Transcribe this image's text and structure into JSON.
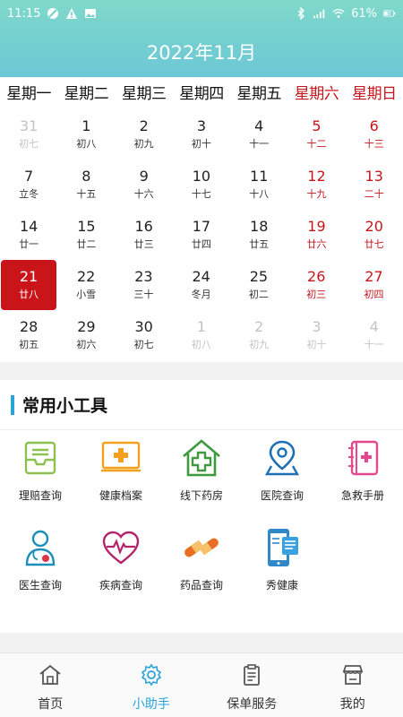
{
  "status_bar": {
    "time": "11:15",
    "battery": "61%"
  },
  "header": {
    "title": "2022年11月"
  },
  "weekdays": [
    "星期一",
    "星期二",
    "星期三",
    "星期四",
    "星期五",
    "星期六",
    "星期日"
  ],
  "calendar": {
    "weeks": [
      [
        {
          "d": "31",
          "l": "初七"
        },
        {
          "d": "1",
          "l": "初八"
        },
        {
          "d": "2",
          "l": "初九"
        },
        {
          "d": "3",
          "l": "初十"
        },
        {
          "d": "4",
          "l": "十一"
        },
        {
          "d": "5",
          "l": "十二"
        },
        {
          "d": "6",
          "l": "十三"
        }
      ],
      [
        {
          "d": "7",
          "l": "立冬"
        },
        {
          "d": "8",
          "l": "十五"
        },
        {
          "d": "9",
          "l": "十六"
        },
        {
          "d": "10",
          "l": "十七"
        },
        {
          "d": "11",
          "l": "十八"
        },
        {
          "d": "12",
          "l": "十九"
        },
        {
          "d": "13",
          "l": "二十"
        }
      ],
      [
        {
          "d": "14",
          "l": "廿一"
        },
        {
          "d": "15",
          "l": "廿二"
        },
        {
          "d": "16",
          "l": "廿三"
        },
        {
          "d": "17",
          "l": "廿四"
        },
        {
          "d": "18",
          "l": "廿五"
        },
        {
          "d": "19",
          "l": "廿六"
        },
        {
          "d": "20",
          "l": "廿七"
        }
      ],
      [
        {
          "d": "21",
          "l": "廿八"
        },
        {
          "d": "22",
          "l": "小雪"
        },
        {
          "d": "23",
          "l": "三十"
        },
        {
          "d": "24",
          "l": "冬月"
        },
        {
          "d": "25",
          "l": "初二"
        },
        {
          "d": "26",
          "l": "初三"
        },
        {
          "d": "27",
          "l": "初四"
        }
      ],
      [
        {
          "d": "28",
          "l": "初五"
        },
        {
          "d": "29",
          "l": "初六"
        },
        {
          "d": "30",
          "l": "初七"
        },
        {
          "d": "1",
          "l": "初八"
        },
        {
          "d": "2",
          "l": "初九"
        },
        {
          "d": "3",
          "l": "初十"
        },
        {
          "d": "4",
          "l": "十一"
        }
      ]
    ]
  },
  "tools_section": {
    "title": "常用小工具",
    "items": [
      {
        "label": "理赔查询",
        "icon": "inbox-tray-icon"
      },
      {
        "label": "健康档案",
        "icon": "monitor-cross-icon"
      },
      {
        "label": "线下药房",
        "icon": "pharmacy-house-icon"
      },
      {
        "label": "医院查询",
        "icon": "location-pin-icon"
      },
      {
        "label": "急救手册",
        "icon": "first-aid-book-icon"
      },
      {
        "label": "医生查询",
        "icon": "doctor-icon"
      },
      {
        "label": "疾病查询",
        "icon": "heartbeat-icon"
      },
      {
        "label": "药品查询",
        "icon": "pill-capsule-icon"
      },
      {
        "label": "秀健康",
        "icon": "phone-document-icon"
      }
    ]
  },
  "tabbar": {
    "tabs": [
      {
        "label": "首页",
        "icon": "home-icon"
      },
      {
        "label": "小助手",
        "icon": "gear-icon"
      },
      {
        "label": "保单服务",
        "icon": "clipboard-icon"
      },
      {
        "label": "我的",
        "icon": "store-icon"
      }
    ],
    "active": "小助手"
  },
  "colors": {
    "header_start": "#7fd9ca",
    "header_end": "#6cc7d6",
    "weekend": "#c5161d",
    "today_bg": "#c9141a",
    "accent": "#2aa4d8"
  }
}
